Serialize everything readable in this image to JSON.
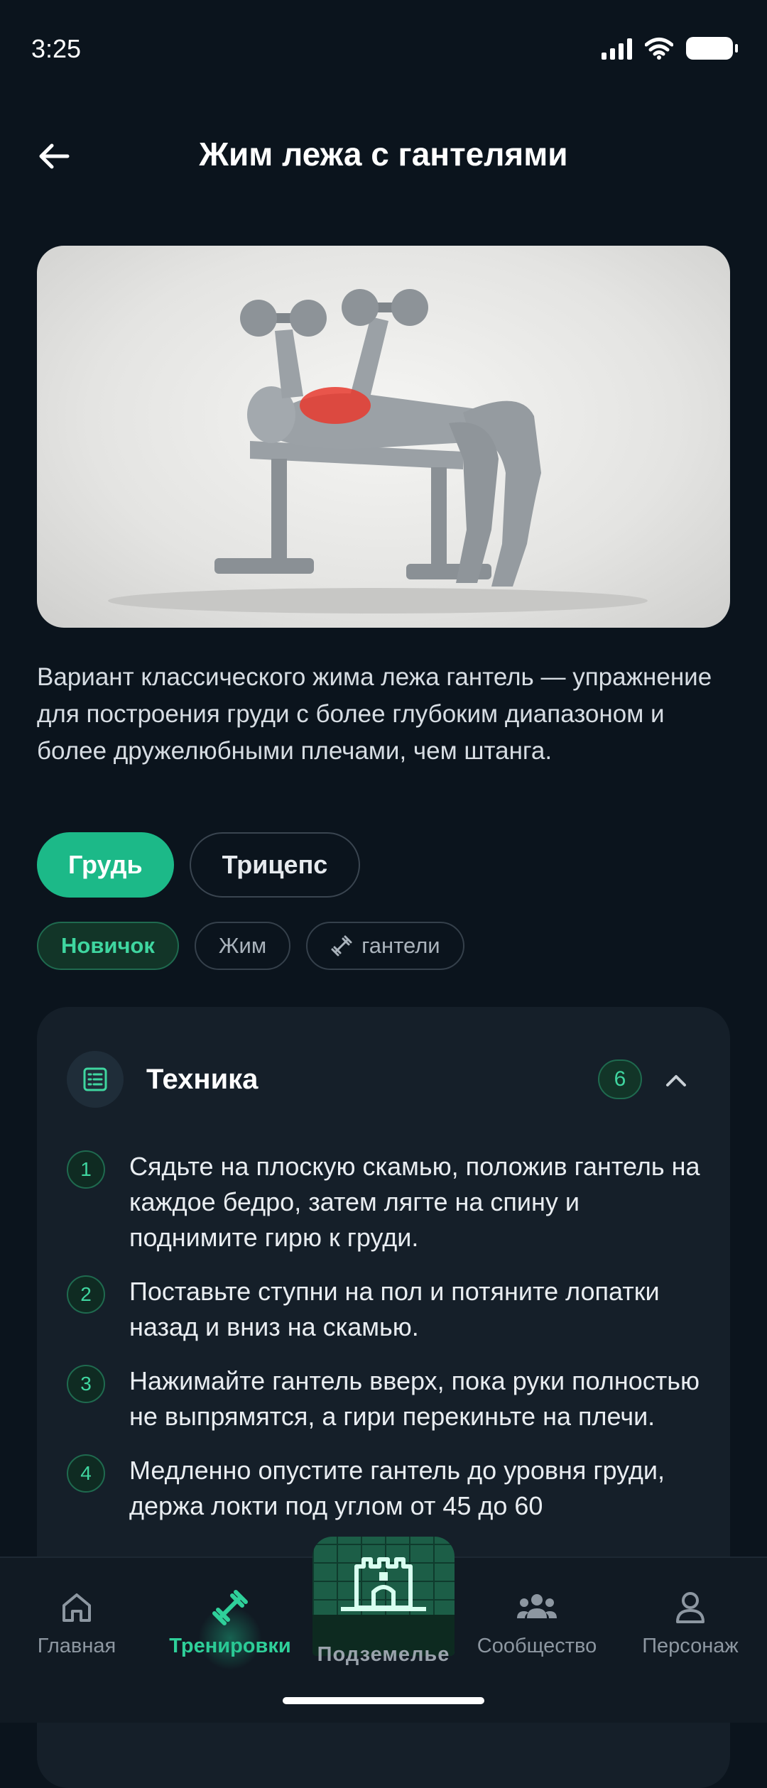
{
  "status_bar": {
    "time": "3:25"
  },
  "header": {
    "title": "Жим лежа с гантелями"
  },
  "description": "Вариант классического жима лежа гантель — упражнение для построения груди с более глубоким диапазоном и более дружелюбными плечами, чем штанга.",
  "muscles": [
    {
      "label": "Грудь",
      "selected": true
    },
    {
      "label": "Трицепс",
      "selected": false
    }
  ],
  "tags": {
    "level": "Новичок",
    "type": "Жим",
    "equipment": "гантели"
  },
  "technique": {
    "title": "Техника",
    "count": "6",
    "steps": [
      {
        "n": "1",
        "text": "Сядьте на плоскую скамью, положив гантель на каждое бедро, затем лягте на спину и поднимите гирю к груди."
      },
      {
        "n": "2",
        "text": "Поставьте ступни на пол и потяните лопатки назад и вниз на скамью."
      },
      {
        "n": "3",
        "text": "Нажимайте гантель вверх, пока руки полностью не выпрямятся, а гири перекиньте на плечи."
      },
      {
        "n": "4",
        "text": "Медленно опустите гантель до уровня груди, держа локти под углом от 45 до 60"
      }
    ]
  },
  "nav": {
    "home": "Главная",
    "workouts": "Тренировки",
    "dungeon": "Подземелье",
    "community": "Сообщество",
    "character": "Персонаж"
  },
  "colors": {
    "background": "#0b141d",
    "accent": "#1cb988",
    "card": "#151f29",
    "highlight_muscle": "#e83a2e"
  }
}
